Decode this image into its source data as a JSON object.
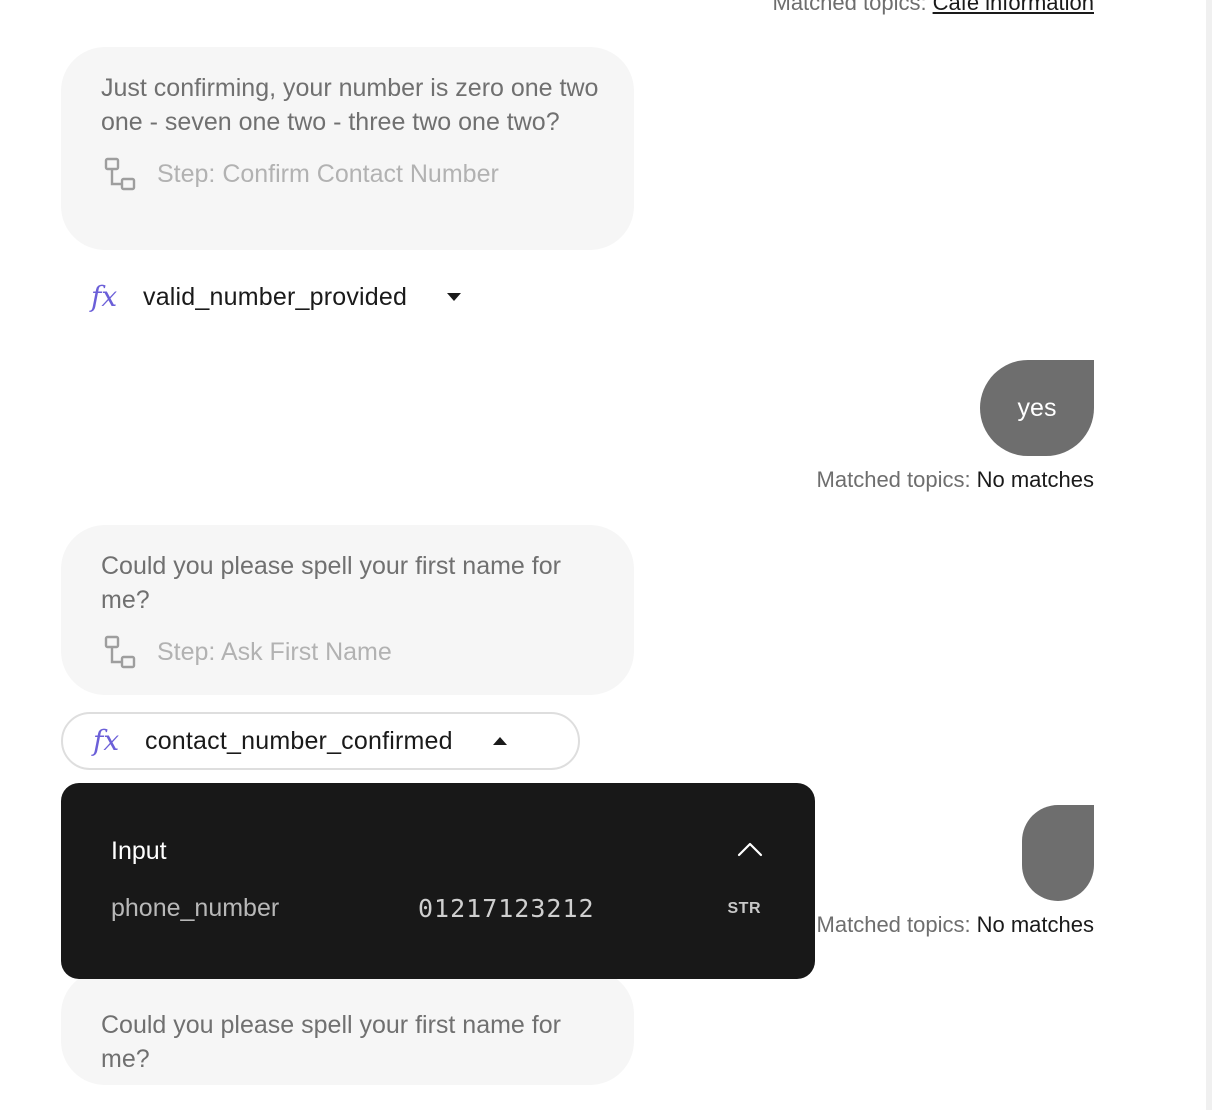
{
  "colors": {
    "accent_fx": "#6b5fd8",
    "user_bubble": "#6e6e6e",
    "bot_bubble": "#f6f6f6",
    "popover_bg": "#181818"
  },
  "top_matched": {
    "label": "Matched topics:",
    "value": "Cafe information"
  },
  "messages": {
    "bot_confirm": {
      "text": "Just confirming, your number is zero one two one - seven one two - three two one two?",
      "step_icon": "flow-step-icon",
      "step": "Step: Confirm Contact Number"
    },
    "fx_valid": {
      "icon": "fx-icon",
      "name": "valid_number_provided",
      "state": "collapsed"
    },
    "user_yes": {
      "text": "yes",
      "matched_label": "Matched topics:",
      "matched_value": "No matches"
    },
    "bot_first_name": {
      "text": "Could you please spell your first name for me?",
      "step_icon": "flow-step-icon",
      "step": "Step: Ask First Name"
    },
    "fx_confirmed": {
      "icon": "fx-icon",
      "name": "contact_number_confirmed",
      "state": "expanded"
    },
    "user_second": {
      "text": "",
      "matched_label": "Matched topics:",
      "matched_value": "No matches"
    },
    "bot_first_name_repeat": {
      "text": "Could you please spell your first name for me?"
    }
  },
  "popover": {
    "title": "Input",
    "param": "phone_number",
    "value": "01217123212",
    "type": "STR"
  }
}
